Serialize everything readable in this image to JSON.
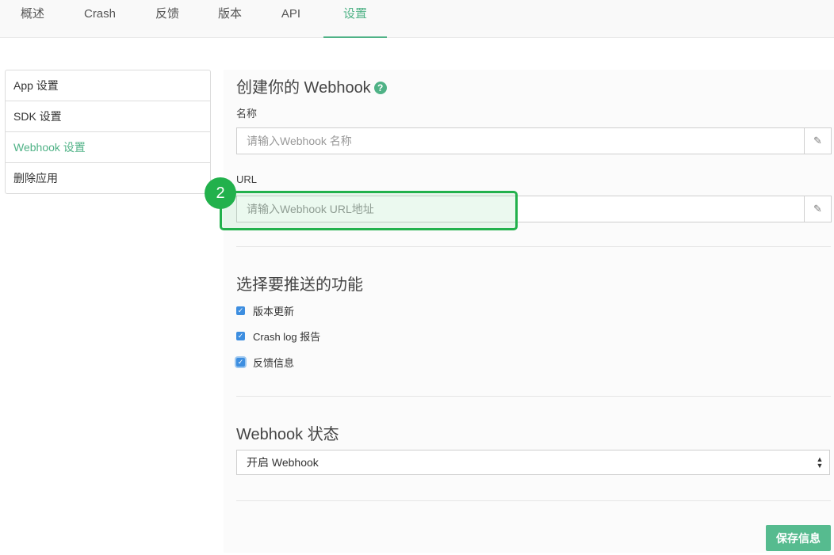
{
  "topnav": {
    "tabs": [
      "概述",
      "Crash",
      "反馈",
      "版本",
      "API",
      "设置"
    ],
    "active_tab": "设置"
  },
  "sidebar": {
    "items": [
      {
        "label": "App 设置"
      },
      {
        "label": "SDK 设置"
      },
      {
        "label": "Webhook 设置",
        "active": true
      },
      {
        "label": "删除应用"
      }
    ]
  },
  "create_section": {
    "title": "创建你的 Webhook",
    "help_glyph": "?",
    "name_label": "名称",
    "name_placeholder": "请输入Webhook 名称",
    "url_label": "URL",
    "url_placeholder": "请输入Webhook URL地址"
  },
  "push_section": {
    "title": "选择要推送的功能",
    "options": [
      {
        "label": "版本更新",
        "checked": true
      },
      {
        "label": "Crash log 报告",
        "checked": true
      },
      {
        "label": "反馈信息",
        "checked": true
      }
    ]
  },
  "status_section": {
    "title": "Webhook 状态",
    "selected": "开启 Webhook"
  },
  "save_label": "保存信息",
  "annotation": {
    "step_number": "2"
  },
  "colors": {
    "accent": "#4fb286",
    "annotation": "#22b14c",
    "checkbox": "#3d8ee0"
  },
  "icons": [
    "help-icon",
    "pencil-icon",
    "checkbox-icon",
    "select-arrows-icon"
  ]
}
